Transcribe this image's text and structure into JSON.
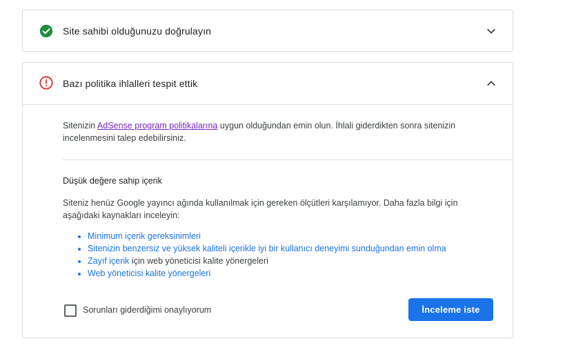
{
  "cards": {
    "verify": {
      "title": "Site sahibi olduğunuzu doğrulayın",
      "status_icon": "check-circle-icon",
      "status_color": "#1e8e3e",
      "chevron": "chevron-down-icon"
    },
    "policy": {
      "title": "Bazı politika ihlalleri tespit ettik",
      "status_icon": "error-circle-icon",
      "status_color": "#d93025",
      "chevron": "chevron-up-icon",
      "intro_before": "Sitenizin ",
      "intro_link": "AdSense program politikalarına",
      "intro_after": " uygun olduğundan emin olun. İhlali giderdikten sonra sitenizin incelenmesini talep edebilirsiniz.",
      "section_title": "Düşük değere sahip içerik",
      "section_desc": "Siteniz henüz Google yayıncı ağında kullanılmak için gereken ölçütleri karşılamıyor. Daha fazla bilgi için aşağıdaki kaynakları inceleyin:",
      "resources": [
        {
          "link": "Minimum içerik gereksinimleri",
          "suffix": ""
        },
        {
          "link": "Sitenizin benzersiz ve yüksek kaliteli içerikle iyi bir kullanıcı deneyimi sunduğundan emin olma",
          "suffix": ""
        },
        {
          "link": "Zayıf içerik",
          "suffix": " için web yöneticisi kalite yönergeleri"
        },
        {
          "link": "Web yöneticisi kalite yönergeleri",
          "suffix": ""
        }
      ],
      "checkbox_label": "Sorunları giderdiğimi onaylıyorum",
      "checkbox_checked": false,
      "button_label": "İnceleme iste"
    }
  },
  "colors": {
    "accent": "#1a73e8",
    "visited_link": "#7627bb",
    "border": "#dadce0"
  }
}
